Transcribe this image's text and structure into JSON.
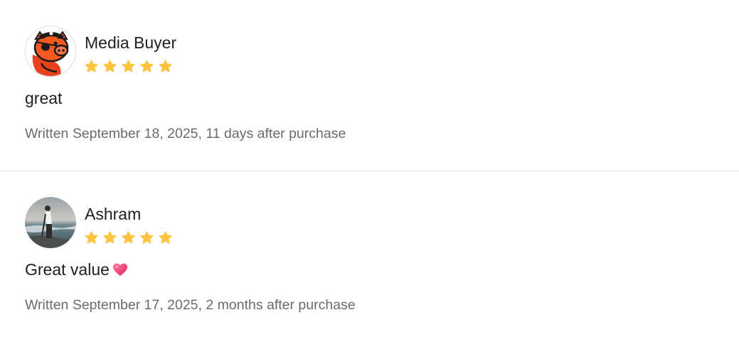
{
  "colors": {
    "star": "#FCC43E",
    "meta_text": "#6b6b6b",
    "divider": "#e6e6e6",
    "heart": "#F2457A"
  },
  "reviews": [
    {
      "name": "Media Buyer",
      "avatar_icon": "pirate-pig-avatar",
      "rating": 5,
      "rating_max": 5,
      "text": "great",
      "meta": "Written September 18, 2025, 11 days after purchase"
    },
    {
      "name": "Ashram",
      "avatar_icon": "beach-photo-avatar",
      "rating": 5,
      "rating_max": 5,
      "text": "Great value",
      "emoji": "heart-emoji",
      "meta": "Written September 17, 2025, 2 months after purchase"
    }
  ]
}
